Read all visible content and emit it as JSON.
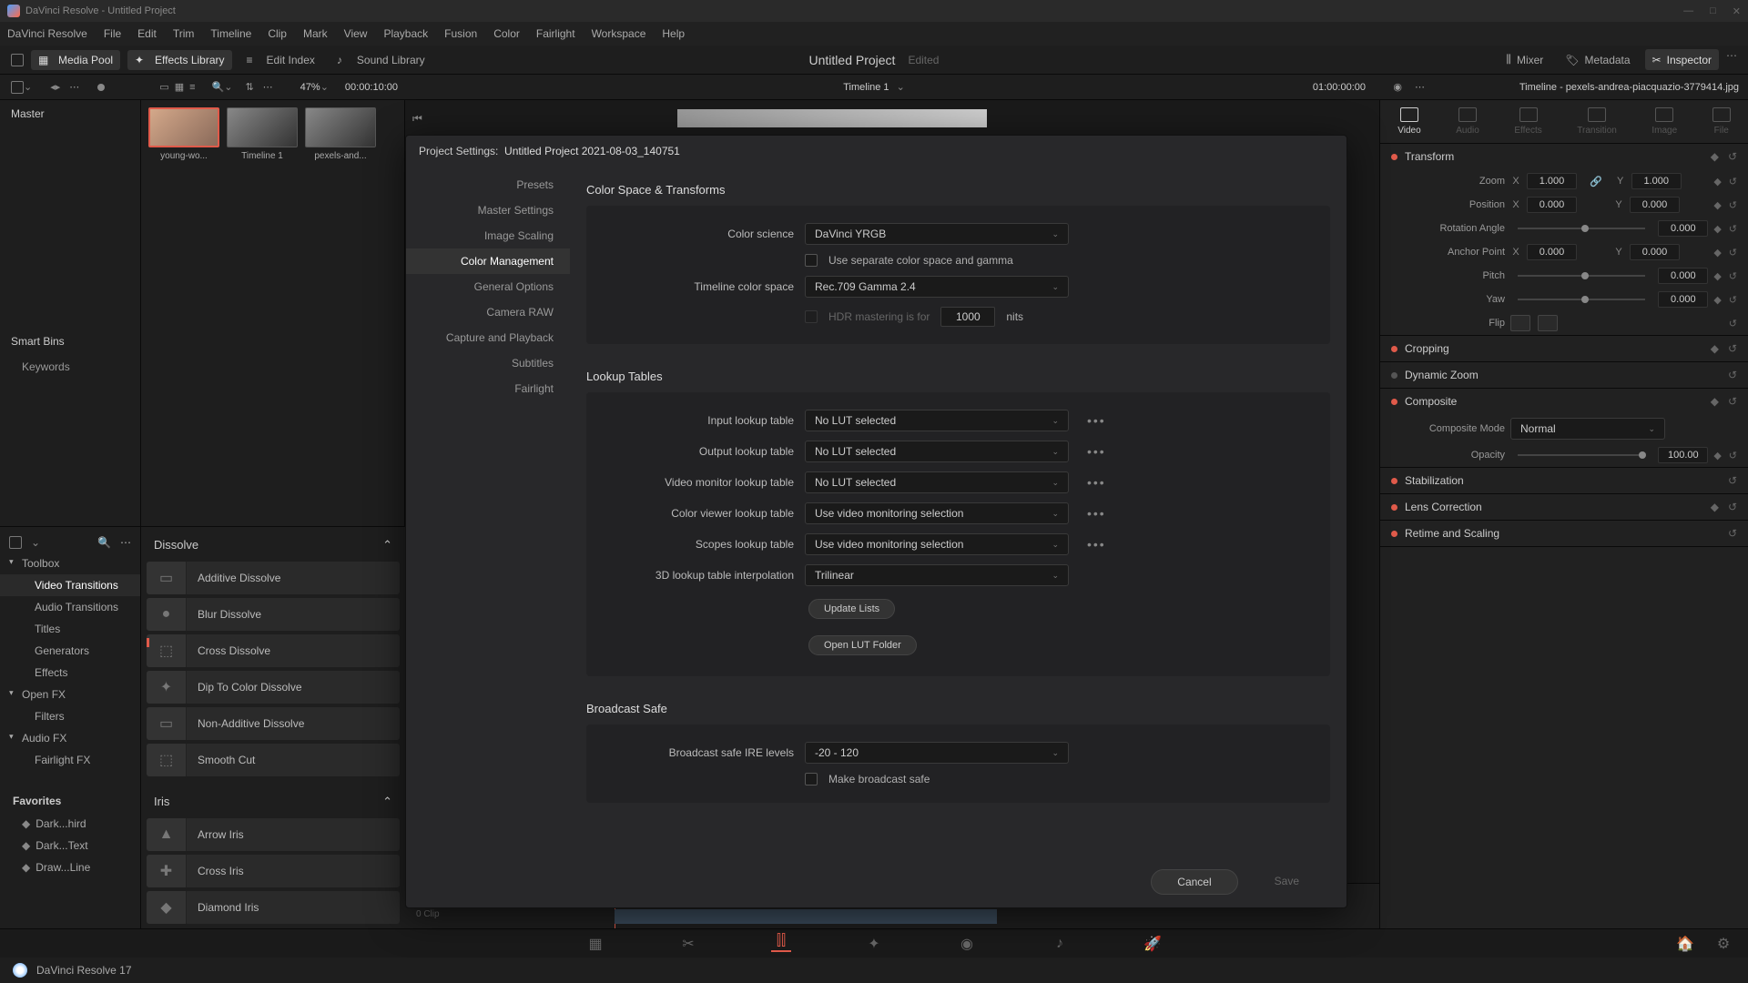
{
  "window": {
    "title": "DaVinci Resolve - Untitled Project"
  },
  "menu": [
    "DaVinci Resolve",
    "File",
    "Edit",
    "Trim",
    "Timeline",
    "Clip",
    "Mark",
    "View",
    "Playback",
    "Fusion",
    "Color",
    "Fairlight",
    "Workspace",
    "Help"
  ],
  "toolbar": {
    "media_pool": "Media Pool",
    "effects_library": "Effects Library",
    "edit_index": "Edit Index",
    "sound_library": "Sound Library",
    "project_title": "Untitled Project",
    "project_status": "Edited",
    "mixer": "Mixer",
    "metadata": "Metadata",
    "inspector": "Inspector"
  },
  "secondary": {
    "zoom_pct": "47%",
    "timecode_left": "00:00:10:00",
    "timeline_name": "Timeline 1",
    "timecode_right": "01:00:00:00",
    "inspector_title": "Timeline - pexels-andrea-piacquazio-3779414.jpg"
  },
  "left": {
    "master": "Master",
    "smart_bins": "Smart Bins",
    "keywords": "Keywords"
  },
  "thumbs": [
    {
      "label": "young-wo..."
    },
    {
      "label": "Timeline 1"
    },
    {
      "label": "pexels-and..."
    }
  ],
  "effects": {
    "tree": {
      "toolbox": "Toolbox",
      "video_transitions": "Video Transitions",
      "audio_transitions": "Audio Transitions",
      "titles": "Titles",
      "generators": "Generators",
      "fx": "Effects",
      "open_fx": "Open FX",
      "filters": "Filters",
      "audio_fx": "Audio FX",
      "fairlight_fx": "Fairlight FX",
      "favorites": "Favorites",
      "fav1": "Dark...hird",
      "fav2": "Dark...Text",
      "fav3": "Draw...Line"
    },
    "group1": "Dissolve",
    "items1": [
      "Additive Dissolve",
      "Blur Dissolve",
      "Cross Dissolve",
      "Dip To Color Dissolve",
      "Non-Additive Dissolve",
      "Smooth Cut"
    ],
    "group2": "Iris",
    "items2": [
      "Arrow Iris",
      "Cross Iris",
      "Diamond Iris"
    ]
  },
  "inspector": {
    "tabs": [
      "Video",
      "Audio",
      "Effects",
      "Transition",
      "Image",
      "File"
    ],
    "transform": {
      "title": "Transform",
      "zoom": "Zoom",
      "zoom_x": "1.000",
      "zoom_y": "1.000",
      "position": "Position",
      "pos_x": "0.000",
      "pos_y": "0.000",
      "rotation": "Rotation Angle",
      "rot_v": "0.000",
      "anchor": "Anchor Point",
      "anc_x": "0.000",
      "anc_y": "0.000",
      "pitch": "Pitch",
      "pitch_v": "0.000",
      "yaw": "Yaw",
      "yaw_v": "0.000",
      "flip": "Flip"
    },
    "cropping": "Cropping",
    "dynamic_zoom": "Dynamic Zoom",
    "composite": {
      "title": "Composite",
      "mode_lbl": "Composite Mode",
      "mode": "Normal",
      "opacity_lbl": "Opacity",
      "opacity": "100.00"
    },
    "stabilization": "Stabilization",
    "lens": "Lens Correction",
    "retime": "Retime and Scaling"
  },
  "modal": {
    "title_prefix": "Project Settings:",
    "title_name": "Untitled Project 2021-08-03_140751",
    "nav": [
      "Presets",
      "Master Settings",
      "Image Scaling",
      "Color Management",
      "General Options",
      "Camera RAW",
      "Capture and Playback",
      "Subtitles",
      "Fairlight"
    ],
    "s1": {
      "title": "Color Space & Transforms",
      "color_science_lbl": "Color science",
      "color_science": "DaVinci YRGB",
      "separate_lbl": "Use separate color space and gamma",
      "timeline_cs_lbl": "Timeline color space",
      "timeline_cs": "Rec.709 Gamma 2.4",
      "hdr_lbl": "HDR mastering is for",
      "hdr_val": "1000",
      "hdr_unit": "nits"
    },
    "s2": {
      "title": "Lookup Tables",
      "input_lbl": "Input lookup table",
      "input": "No LUT selected",
      "output_lbl": "Output lookup table",
      "output": "No LUT selected",
      "monitor_lbl": "Video monitor lookup table",
      "monitor": "No LUT selected",
      "viewer_lbl": "Color viewer lookup table",
      "viewer": "Use video monitoring selection",
      "scopes_lbl": "Scopes lookup table",
      "scopes": "Use video monitoring selection",
      "interp_lbl": "3D lookup table interpolation",
      "interp": "Trilinear",
      "update": "Update Lists",
      "open_folder": "Open LUT Folder"
    },
    "s3": {
      "title": "Broadcast Safe",
      "ire_lbl": "Broadcast safe IRE levels",
      "ire": "-20 - 120",
      "make_lbl": "Make broadcast safe"
    },
    "cancel": "Cancel",
    "save": "Save"
  },
  "timeline_bottom": {
    "clip": "0 Clip"
  },
  "status": {
    "app": "DaVinci Resolve 17"
  }
}
